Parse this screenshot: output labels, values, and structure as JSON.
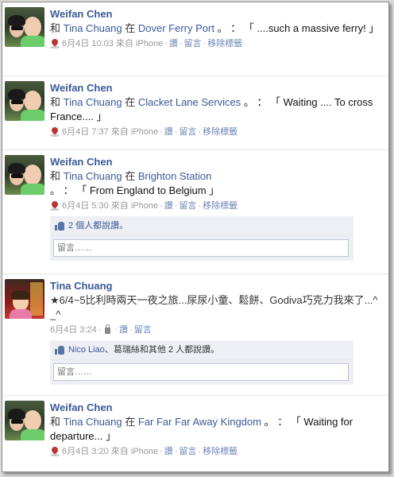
{
  "stories": [
    {
      "actor": "Weifan Chen",
      "msg_prefix": "和",
      "with_name": "Tina Chuang",
      "at_word": "在",
      "place": "Dover Ferry Port",
      "post": "。 ： 「 ....such a massive ferry! 」",
      "date": "6月4日 10:03 來自 iPhone",
      "like": "讚",
      "comment": "留言",
      "remove": "移除標籤"
    },
    {
      "actor": "Weifan Chen",
      "msg_prefix": "和",
      "with_name": "Tina Chuang",
      "at_word": "在",
      "place": "Clacket Lane Services",
      "post": "。 ： 「 Waiting .... To cross France.... 」",
      "date": "6月4日 7:37 來自 iPhone",
      "like": "讚",
      "comment": "留言",
      "remove": "移除標籤"
    },
    {
      "actor": "Weifan Chen",
      "msg_prefix": "和",
      "with_name": "Tina Chuang",
      "at_word": "在",
      "place": "Brighton Station",
      "post": "。 ： 「 From England to Belgium 」",
      "date": "6月4日 5:30 來自 iPhone",
      "like": "讚",
      "comment": "留言",
      "remove": "移除標籤",
      "likes_text": "2 個人都說讚。",
      "comment_placeholder": "留言……"
    },
    {
      "actor": "Tina Chuang",
      "text": "★6/4~5比利時兩天一夜之旅...尿尿小童、鬆餅、Godiva巧克力我來了...^_^",
      "date": "6月4日 3:24",
      "like": "讚",
      "comment": "留言",
      "likes_name": "Nico Liao",
      "likes_rest": "、葛瑞絲和其他 2 人都說讚。",
      "comment_placeholder": "留言……"
    },
    {
      "actor": "Weifan Chen",
      "msg_prefix": "和",
      "with_name": "Tina Chuang",
      "at_word": "在",
      "place": "Far Far Far Away Kingdom",
      "post": "。 ： 「 Waiting for departure... 」",
      "date": "6月4日 3:20 來自 iPhone",
      "like": "讚",
      "comment": "留言",
      "remove": "移除標籤"
    }
  ]
}
